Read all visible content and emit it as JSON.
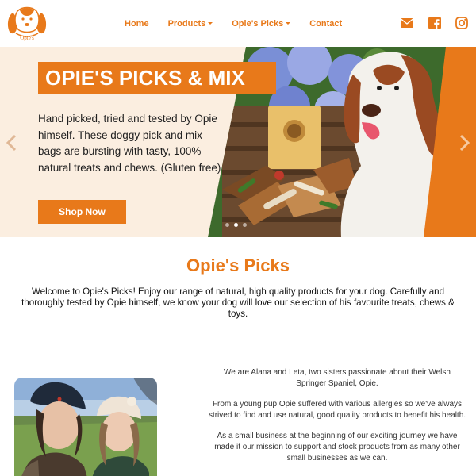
{
  "header": {
    "logo_text": "Opie's",
    "nav": [
      {
        "label": "Home"
      },
      {
        "label": "Products"
      },
      {
        "label": "Opie's Picks"
      },
      {
        "label": "Contact"
      }
    ],
    "social_icons": [
      "envelope-icon",
      "facebook-icon",
      "instagram-icon"
    ]
  },
  "hero": {
    "title": "OPIE'S PICKS & MIX",
    "text": "Hand picked, tried and tested by Opie himself. These doggy pick and mix bags are bursting with tasty, 100% natural treats and chews. (Gluten free)",
    "button": "Shop Now",
    "slides": 3,
    "active_slide": 2
  },
  "picks": {
    "title": "Opie's Picks",
    "text": "Welcome to Opie's Picks! Enjoy our range of natural, high quality products for your dog. Carefully and thoroughly tested by Opie himself, we know your dog will love our selection of his favourite treats, chews & toys."
  },
  "about": {
    "paragraphs": [
      "We are Alana and Leta, two sisters passionate about their Welsh Springer Spaniel, Opie.",
      "From a young pup Opie suffered with various allergies so we've always strived to find and use natural, good quality products to benefit his health.",
      "As a small business at the beginning of our exciting journey we have made it our mission to support and stock products from as many other small businesses as we can."
    ]
  },
  "colors": {
    "accent": "#e8791a",
    "hero_bg": "#fbeee0"
  }
}
